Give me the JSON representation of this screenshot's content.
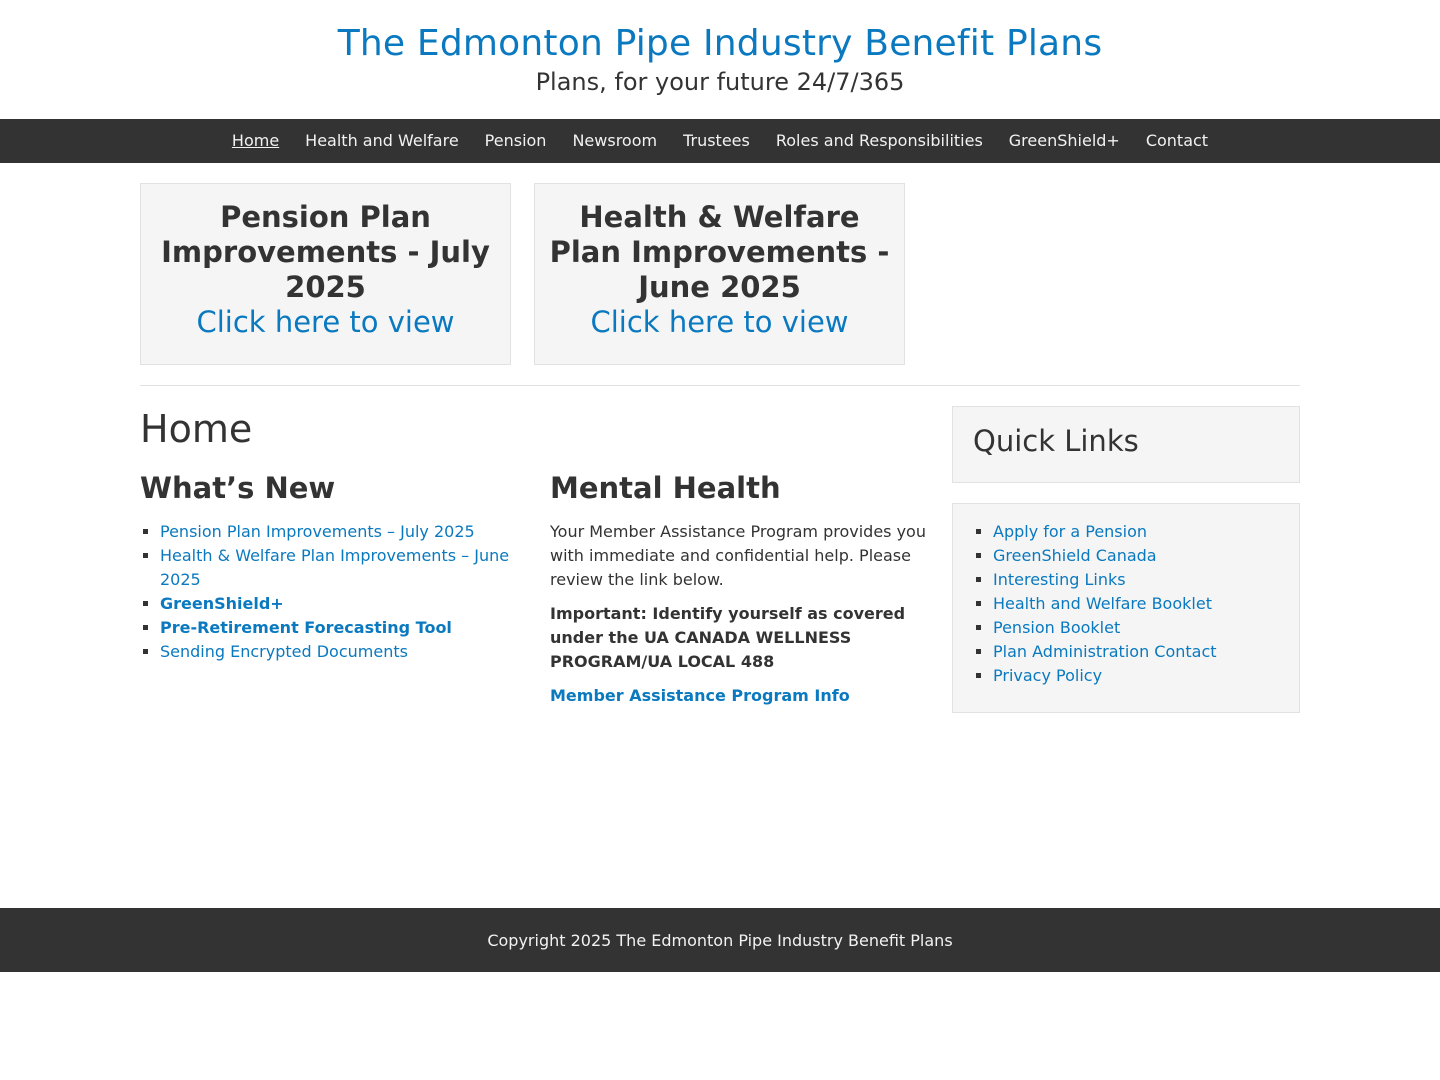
{
  "site": {
    "title": "The Edmonton Pipe Industry Benefit Plans",
    "tagline": "Plans, for your future 24/7/365"
  },
  "nav": {
    "items": [
      {
        "label": "Home",
        "current": true
      },
      {
        "label": "Health and Welfare"
      },
      {
        "label": "Pension"
      },
      {
        "label": "Newsroom"
      },
      {
        "label": "Trustees"
      },
      {
        "label": "Roles and Responsibilities"
      },
      {
        "label": "GreenShield+"
      },
      {
        "label": "Contact"
      }
    ]
  },
  "promos": [
    {
      "title": "Pension Plan Improvements - July 2025",
      "link": "Click here to view"
    },
    {
      "title": "Health & Welfare Plan Improvements - June 2025",
      "link": "Click here to view"
    }
  ],
  "page": {
    "title": "Home"
  },
  "whats_new": {
    "heading": "What’s New",
    "items": [
      "Pension Plan Improvements – July 2025",
      "Health & Welfare Plan Improvements – June 2025",
      "GreenShield+",
      "Pre-Retirement Forecasting Tool",
      "Sending Encrypted Documents"
    ]
  },
  "mental_health": {
    "heading": "Mental Health",
    "body": "Your Member Assistance Program provides you with immediate and confidential help. Please review the link below.",
    "important": "Important: Identify yourself as covered under the UA CANADA WELLNESS PROGRAM/UA LOCAL 488",
    "link": "Member Assistance Program Info"
  },
  "quick_links": {
    "title": "Quick Links",
    "items": [
      "Apply for a Pension",
      "GreenShield Canada",
      "Interesting Links",
      "Health and Welfare Booklet",
      "Pension Booklet",
      "Plan Administration Contact",
      "Privacy Policy"
    ]
  },
  "footer": {
    "copyright": "Copyright 2025 The Edmonton Pipe Industry Benefit Plans"
  },
  "colors": {
    "link": "#0a79bf",
    "nav_bg": "#333333",
    "box_bg": "#f5f5f5"
  }
}
